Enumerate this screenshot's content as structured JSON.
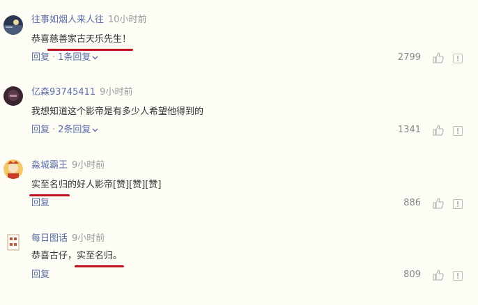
{
  "comments": [
    {
      "username": "往事如烟人来人往",
      "time": "10小时前",
      "text_pre": "恭喜",
      "text_ul": "慈善家古天乐先生！",
      "text_post": "",
      "reply": "回复",
      "sub_replies": "1条回复",
      "likes": "2799"
    },
    {
      "username": "亿森93745411",
      "time": "9小时前",
      "text_pre": "我想知道这个影帝是有多少人希望他得到的",
      "text_ul": "",
      "text_post": "",
      "reply": "回复",
      "sub_replies": "2条回复",
      "likes": "1341"
    },
    {
      "username": "淼城霸王",
      "time": "9小时前",
      "text_pre": "",
      "text_ul": "实至名归",
      "text_post": "的好人影帝[赞][赞][赞]",
      "reply": "回复",
      "sub_replies": "",
      "likes": "886"
    },
    {
      "username": "每日图话",
      "time": "9小时前",
      "text_pre": "恭喜古仔，",
      "text_ul": "实至名归。",
      "text_post": "",
      "reply": "回复",
      "sub_replies": "",
      "likes": "809"
    }
  ],
  "icons": {
    "like": "thumbs-up-icon",
    "report": "report-icon",
    "expand": "chevron-down-icon"
  },
  "colors": {
    "link": "#5a6ea8",
    "underline": "#c0101e",
    "background": "#fdfcf5"
  }
}
